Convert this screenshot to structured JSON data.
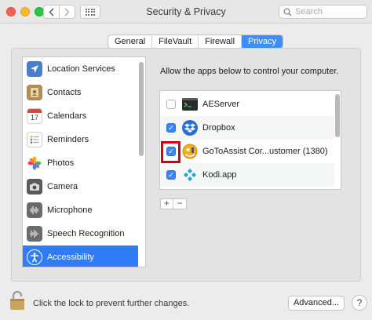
{
  "window": {
    "title": "Security & Privacy"
  },
  "search": {
    "placeholder": "Search"
  },
  "tabs": [
    {
      "label": "General"
    },
    {
      "label": "FileVault"
    },
    {
      "label": "Firewall"
    },
    {
      "label": "Privacy",
      "selected": true
    }
  ],
  "sidebar": {
    "items": [
      {
        "label": "Location Services",
        "icon": "location-arrow-icon"
      },
      {
        "label": "Contacts",
        "icon": "contacts-book-icon"
      },
      {
        "label": "Calendars",
        "icon": "calendar-icon",
        "icon_text": "17"
      },
      {
        "label": "Reminders",
        "icon": "reminders-list-icon"
      },
      {
        "label": "Photos",
        "icon": "photos-flower-icon"
      },
      {
        "label": "Camera",
        "icon": "camera-icon"
      },
      {
        "label": "Microphone",
        "icon": "microphone-waveform-icon"
      },
      {
        "label": "Speech Recognition",
        "icon": "speech-waveform-icon"
      },
      {
        "label": "Accessibility",
        "icon": "accessibility-person-icon",
        "selected": true
      }
    ]
  },
  "main": {
    "instruction": "Allow the apps below to control your computer.",
    "apps": [
      {
        "name": "AEServer",
        "checked": false,
        "icon": "terminal-icon"
      },
      {
        "name": "Dropbox",
        "checked": true,
        "icon": "dropbox-icon"
      },
      {
        "name": "GoToAssist Cor...ustomer (1380)",
        "checked": true,
        "icon": "gotoassist-icon",
        "highlighted": true
      },
      {
        "name": "Kodi.app",
        "checked": true,
        "icon": "kodi-icon"
      }
    ],
    "add_label": "+",
    "remove_label": "−"
  },
  "footer": {
    "lock_text": "Click the lock to prevent further changes.",
    "advanced_label": "Advanced...",
    "help_label": "?"
  },
  "colors": {
    "accent": "#2f7cf6",
    "highlight_border": "#d0021b"
  }
}
